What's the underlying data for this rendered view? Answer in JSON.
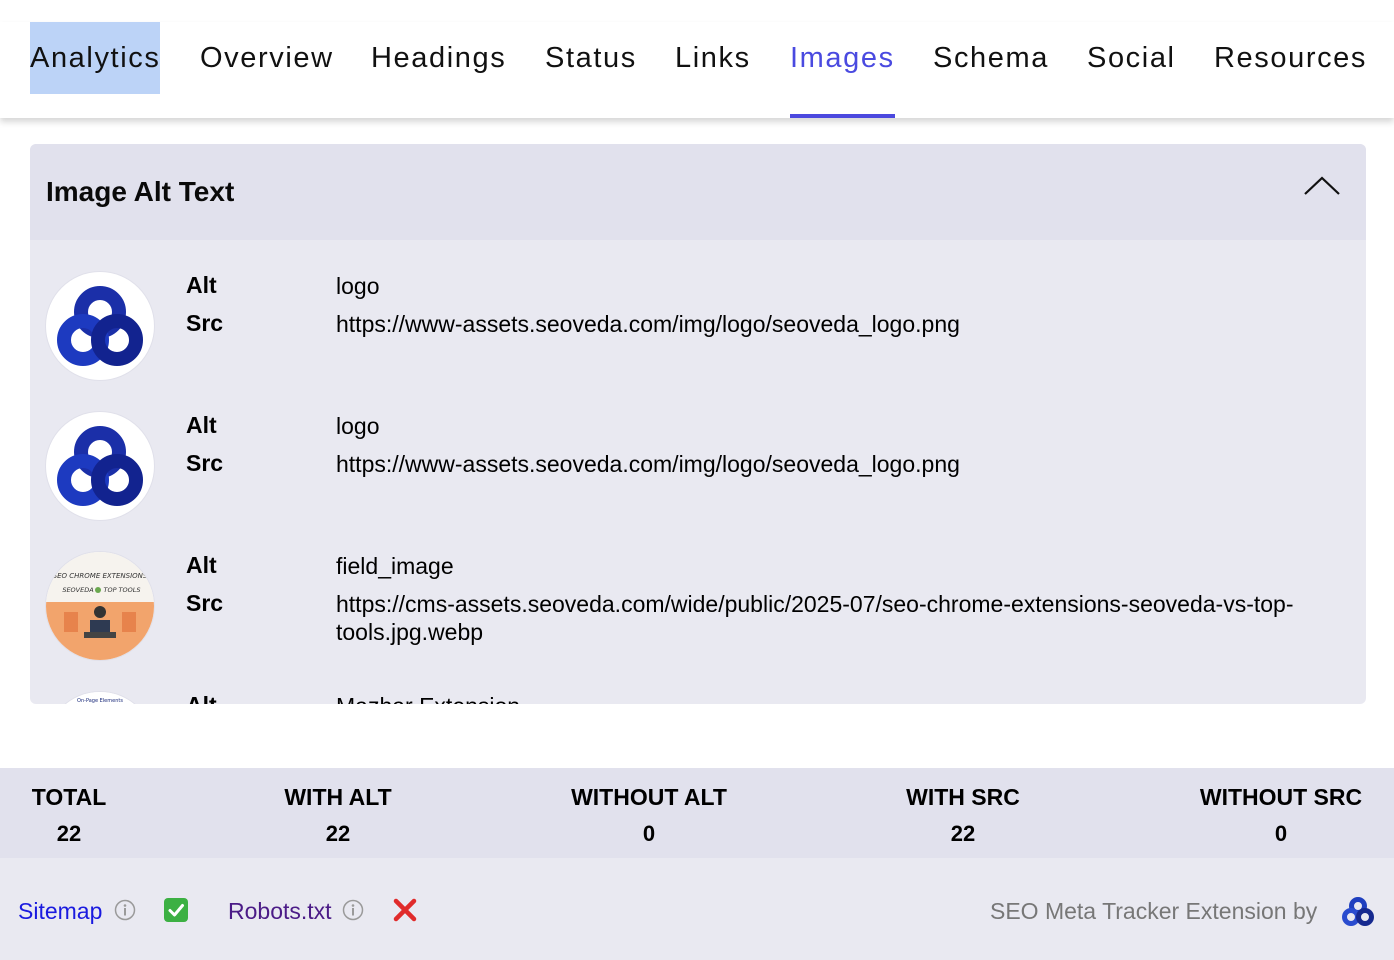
{
  "tabs": [
    {
      "label": "Analytics",
      "selected": true,
      "active": false
    },
    {
      "label": "Overview",
      "selected": false,
      "active": false
    },
    {
      "label": "Headings",
      "selected": false,
      "active": false
    },
    {
      "label": "Status",
      "selected": false,
      "active": false
    },
    {
      "label": "Links",
      "selected": false,
      "active": false
    },
    {
      "label": "Images",
      "selected": false,
      "active": true
    },
    {
      "label": "Schema",
      "selected": false,
      "active": false
    },
    {
      "label": "Social",
      "selected": false,
      "active": false
    },
    {
      "label": "Resources",
      "selected": false,
      "active": false
    }
  ],
  "panel": {
    "title": "Image Alt Text",
    "collapse_icon": "chevron-up-icon",
    "alt_label": "Alt",
    "src_label": "Src",
    "images": [
      {
        "thumb": "seoveda-logo",
        "alt": "logo",
        "src": "https://www-assets.seoveda.com/img/logo/seoveda_logo.png"
      },
      {
        "thumb": "seoveda-logo",
        "alt": "logo",
        "src": "https://www-assets.seoveda.com/img/logo/seoveda_logo.png"
      },
      {
        "thumb": "article-illustration",
        "thumb_caption_1": "SEO CHROME EXTENSIONS",
        "thumb_caption_2": "SEOVEDA",
        "thumb_caption_3": "TOP TOOLS",
        "alt": "field_image",
        "src": "https://cms-assets.seoveda.com/wide/public/2025-07/seo-chrome-extensions-seoveda-vs-top-tools.jpg.webp"
      },
      {
        "thumb": "partial-thumbnail",
        "thumb_caption_1": "On-Page Elements",
        "alt": "Mazhar Extension",
        "src": ""
      }
    ]
  },
  "stats": [
    {
      "label": "TOTAL",
      "value": "22"
    },
    {
      "label": "WITH ALT",
      "value": "22"
    },
    {
      "label": "WITHOUT ALT",
      "value": "0"
    },
    {
      "label": "WITH SRC",
      "value": "22"
    },
    {
      "label": "WITHOUT SRC",
      "value": "0"
    }
  ],
  "footer": {
    "sitemap_label": "Sitemap",
    "sitemap_status_icon": "check-mark-icon",
    "robots_label": "Robots.txt",
    "robots_status_icon": "cross-mark-icon",
    "credit": "SEO Meta Tracker Extension by",
    "brand_icon": "seoveda-logo-icon"
  },
  "colors": {
    "accent": "#4b48de",
    "selection": "#bcd3f7",
    "panel_bg": "#e9e9f1",
    "header_bg": "#e1e1ed",
    "sitemap_link": "#1a1adf",
    "robots_link": "#4b1b87",
    "brand_blue": "#1f3fbf"
  }
}
